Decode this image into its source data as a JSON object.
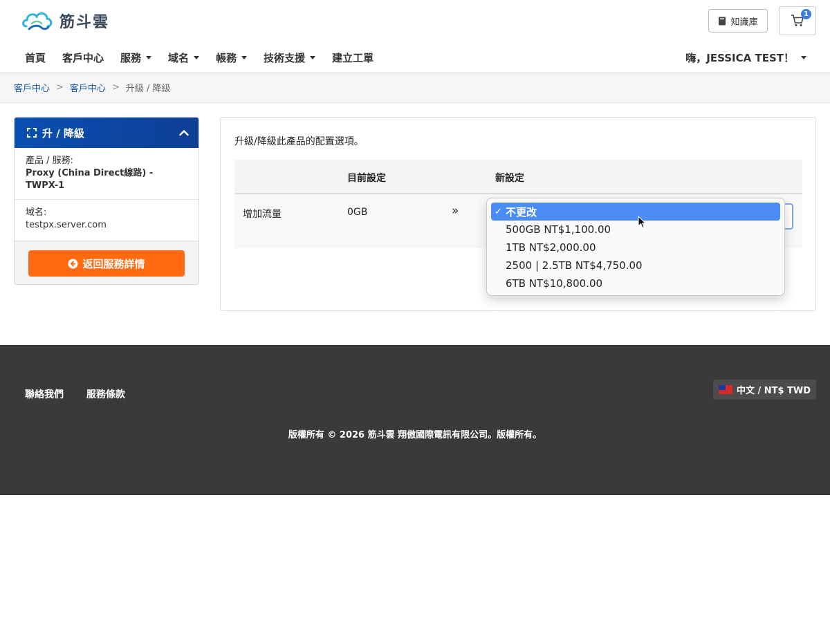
{
  "brand": {
    "name": "筋斗雲"
  },
  "header": {
    "kb_label": "知識庫",
    "cart_count": "1",
    "nav": [
      {
        "label": "首頁",
        "dropdown": false
      },
      {
        "label": "客戶中心",
        "dropdown": false
      },
      {
        "label": "服務",
        "dropdown": true
      },
      {
        "label": "域名",
        "dropdown": true
      },
      {
        "label": "帳務",
        "dropdown": true
      },
      {
        "label": "技術支援",
        "dropdown": true
      },
      {
        "label": "建立工單",
        "dropdown": false
      }
    ],
    "user_greeting": "嗨，JESSICA TEST！"
  },
  "breadcrumb": {
    "items": [
      "客戶中心",
      "客戶中心"
    ],
    "separator": ">",
    "current": "升級 / 降級"
  },
  "sidebar": {
    "title": "升 / 降級",
    "product_label": "產品 / 服務:",
    "product_value": "Proxy (China Direct線路) - TWPX-1",
    "domain_label": "域名:",
    "domain_value": "testpx.server.com",
    "back_button": "返回服務詳情"
  },
  "main": {
    "intro": "升級/降級此產品的配置選項。",
    "columns": {
      "current": "目前設定",
      "new": "新設定"
    },
    "row": {
      "option": "增加流量",
      "current": "0GB",
      "arrow": "»"
    }
  },
  "dropdown": {
    "options": [
      {
        "label": "不更改",
        "selected": true,
        "check": "✓"
      },
      {
        "label": "500GB NT$1,100.00",
        "selected": false
      },
      {
        "label": "1TB NT$2,000.00",
        "selected": false
      },
      {
        "label": "2500 | 2.5TB NT$4,750.00",
        "selected": false
      },
      {
        "label": "6TB NT$10,800.00",
        "selected": false
      }
    ]
  },
  "footer": {
    "links": [
      "聯絡我們",
      "服務條款"
    ],
    "language": "中文 / NT$ TWD",
    "copyright": "版權所有 © 2026 筋斗雲 翔傲國際電訊有限公司。版權所有。"
  },
  "colors": {
    "primary": "#0a4fb0",
    "accent": "#ff6a13",
    "select_highlight": "#4a8cf3",
    "footer_bg": "#3a3a3a"
  }
}
